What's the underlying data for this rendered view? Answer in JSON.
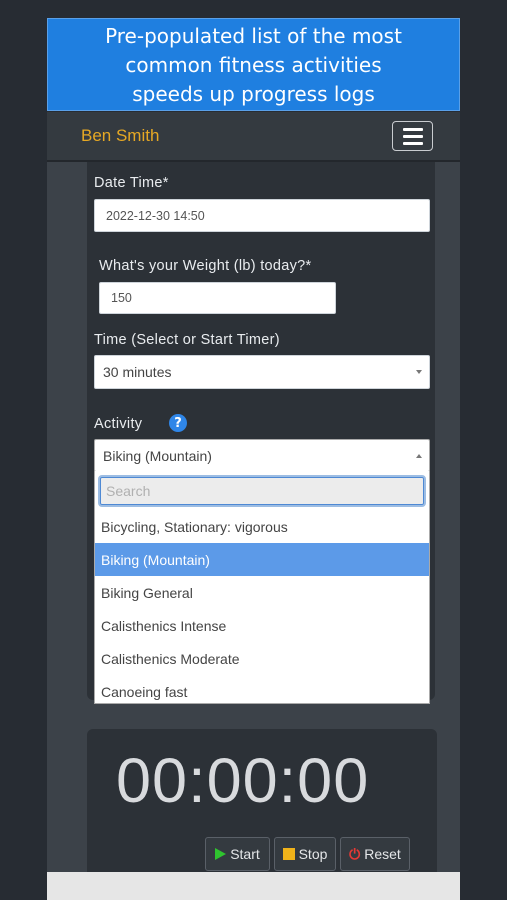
{
  "banner": {
    "lines": [
      "Pre-populated list of the most",
      "common fitness activities",
      "speeds up progress logs"
    ]
  },
  "header": {
    "user_name": "Ben Smith",
    "menu_icon": "hamburger-menu-icon"
  },
  "form": {
    "date_time_label": "Date Time*",
    "date_time_value": "2022-12-30 14:50",
    "weight_label": "What's your Weight (lb) today?*",
    "weight_value": "150",
    "time_label": "Time (Select or Start Timer)",
    "time_selected": "30 minutes",
    "activity_label": "Activity",
    "activity_selected": "Biking (Mountain)",
    "help_icon": "?"
  },
  "dropdown": {
    "search_placeholder": "Search",
    "options": [
      "Bicycling, Stationary: vigorous",
      "Biking (Mountain)",
      "Biking General",
      "Calisthenics Intense",
      "Calisthenics Moderate",
      "Canoeing fast"
    ],
    "selected": "Biking (Mountain)"
  },
  "timer": {
    "display": "00:00:00",
    "start_label": "Start",
    "stop_label": "Stop",
    "reset_label": "Reset"
  },
  "colors": {
    "banner_bg": "#1f7fe0",
    "brand": "#e6a824",
    "selected_option": "#5c9ae8",
    "start_icon": "#2fc42f",
    "stop_icon": "#f0b31a",
    "reset_icon": "#e53935"
  }
}
